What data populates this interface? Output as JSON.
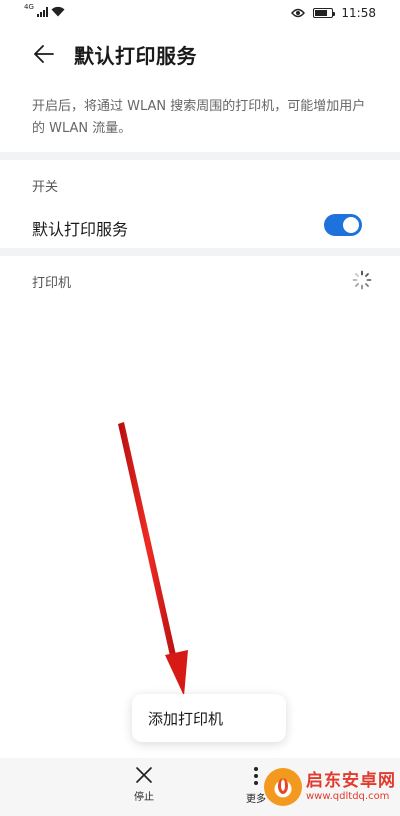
{
  "status_bar": {
    "network_type": "4G",
    "time": "11:58",
    "battery_level": 0.8
  },
  "header": {
    "title": "默认打印服务"
  },
  "description": "开启后，将通过 WLAN 搜索周围的打印机，可能增加用户的 WLAN 流量。",
  "switch_section": {
    "title": "开关",
    "label": "默认打印服务",
    "enabled": true
  },
  "printers_section": {
    "title": "打印机"
  },
  "popup_menu": {
    "items": [
      "添加打印机"
    ]
  },
  "bottom_bar": {
    "stop_label": "停止",
    "more_label": "更多"
  },
  "watermark": {
    "title": "启东安卓网",
    "url": "www.qdltdq.com"
  },
  "colors": {
    "accent": "#1e72dc",
    "annotation_arrow": "#e0201b"
  }
}
